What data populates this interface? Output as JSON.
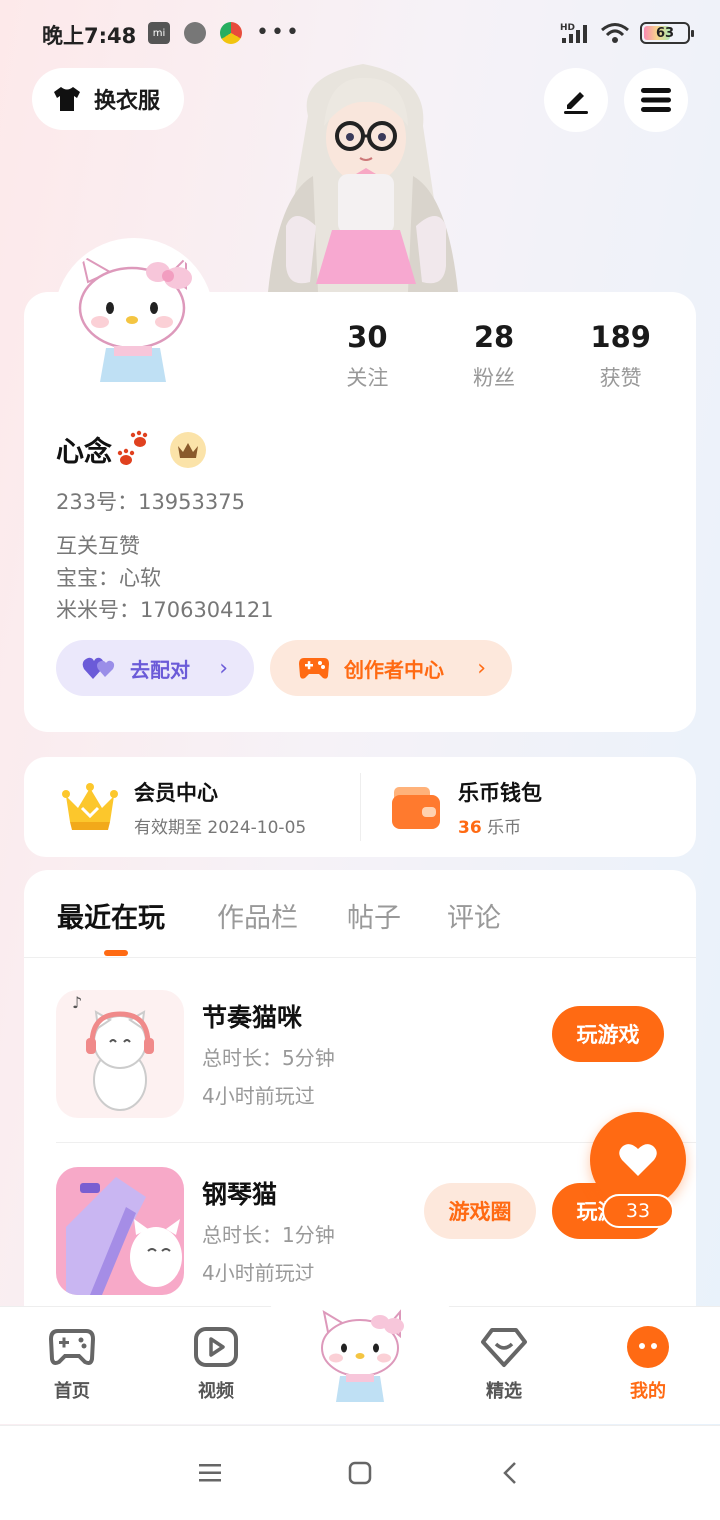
{
  "status_bar": {
    "time": "晚上7:48",
    "network": "HD",
    "battery": "63",
    "battery_level": 0.63
  },
  "header": {
    "outfit_label": "换衣服",
    "edit_icon": "edit-icon",
    "menu_icon": "menu-icon"
  },
  "profile": {
    "stats": [
      {
        "value": "30",
        "label": "关注"
      },
      {
        "value": "28",
        "label": "粉丝"
      },
      {
        "value": "189",
        "label": "获赞"
      }
    ],
    "nickname": "心念",
    "uid": "233号：13953375",
    "bio_lines": [
      "互关互赞",
      "宝宝：心软",
      "米米号：1706304121"
    ],
    "pair_label": "去配对",
    "creator_label": "创作者中心"
  },
  "vip": {
    "member_title": "会员中心",
    "member_sub": "有效期至 2024-10-05",
    "wallet_title": "乐币钱包",
    "wallet_amount": "36",
    "wallet_unit": "乐币"
  },
  "tabs": [
    "最近在玩",
    "作品栏",
    "帖子",
    "评论"
  ],
  "games": [
    {
      "name": "节奏猫咪",
      "duration": "总时长：5分钟",
      "last_played": "4小时前玩过",
      "play_label": "玩游戏"
    },
    {
      "name": "钢琴猫",
      "duration": "总时长：1分钟",
      "last_played": "4小时前玩过",
      "play_label": "玩游戏",
      "circle_label": "游戏圈"
    }
  ],
  "like": {
    "count": "33"
  },
  "bottom_nav": [
    {
      "label": "首页"
    },
    {
      "label": "视频"
    },
    {
      "label": "精选"
    },
    {
      "label": "我的"
    }
  ],
  "colors": {
    "accent": "#ff6a13",
    "pair": "#6b5bd8"
  }
}
